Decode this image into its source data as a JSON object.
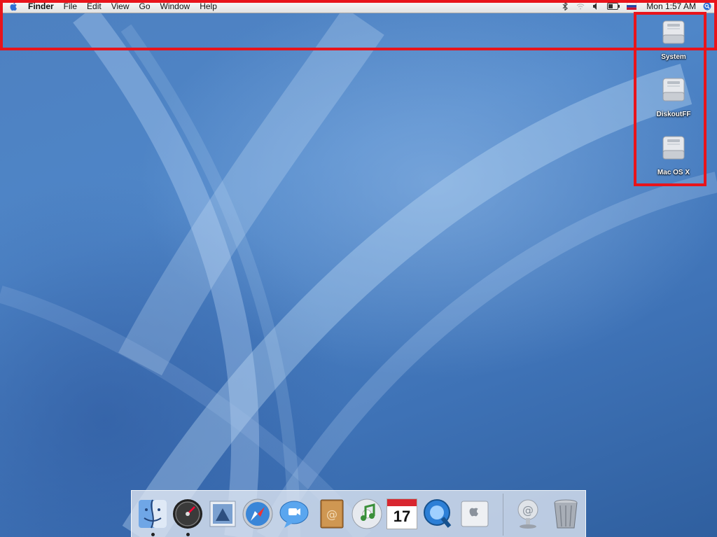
{
  "menubar": {
    "finder": "Finder",
    "file": "File",
    "edit": "Edit",
    "view": "View",
    "go": "Go",
    "window": "Window",
    "help": "Help",
    "clock": "Mon 1:57 AM"
  },
  "desktop_icons": [
    {
      "label": "System",
      "icon": "hard-drive-icon"
    },
    {
      "label": "DiskoutFF",
      "icon": "hard-drive-icon"
    },
    {
      "label": "Mac OS X",
      "icon": "hard-drive-icon"
    }
  ],
  "dock": {
    "items": [
      {
        "name": "finder",
        "icon": "finder-icon"
      },
      {
        "name": "dashboard",
        "icon": "dashboard-icon"
      },
      {
        "name": "mail",
        "icon": "mail-icon"
      },
      {
        "name": "safari",
        "icon": "safari-icon"
      },
      {
        "name": "ichat",
        "icon": "ichat-icon"
      },
      {
        "name": "address-book",
        "icon": "address-book-icon"
      },
      {
        "name": "itunes",
        "icon": "itunes-icon"
      },
      {
        "name": "ical",
        "icon": "ical-icon"
      },
      {
        "name": "quicktime",
        "icon": "quicktime-icon"
      },
      {
        "name": "system-preferences",
        "icon": "preferences-icon"
      },
      {
        "name": "network",
        "icon": "network-icon"
      },
      {
        "name": "trash",
        "icon": "trash-icon"
      }
    ],
    "ical_date": "17"
  },
  "colors": {
    "highlight": "#e8141b",
    "wallpaper": "#4f86c8"
  }
}
